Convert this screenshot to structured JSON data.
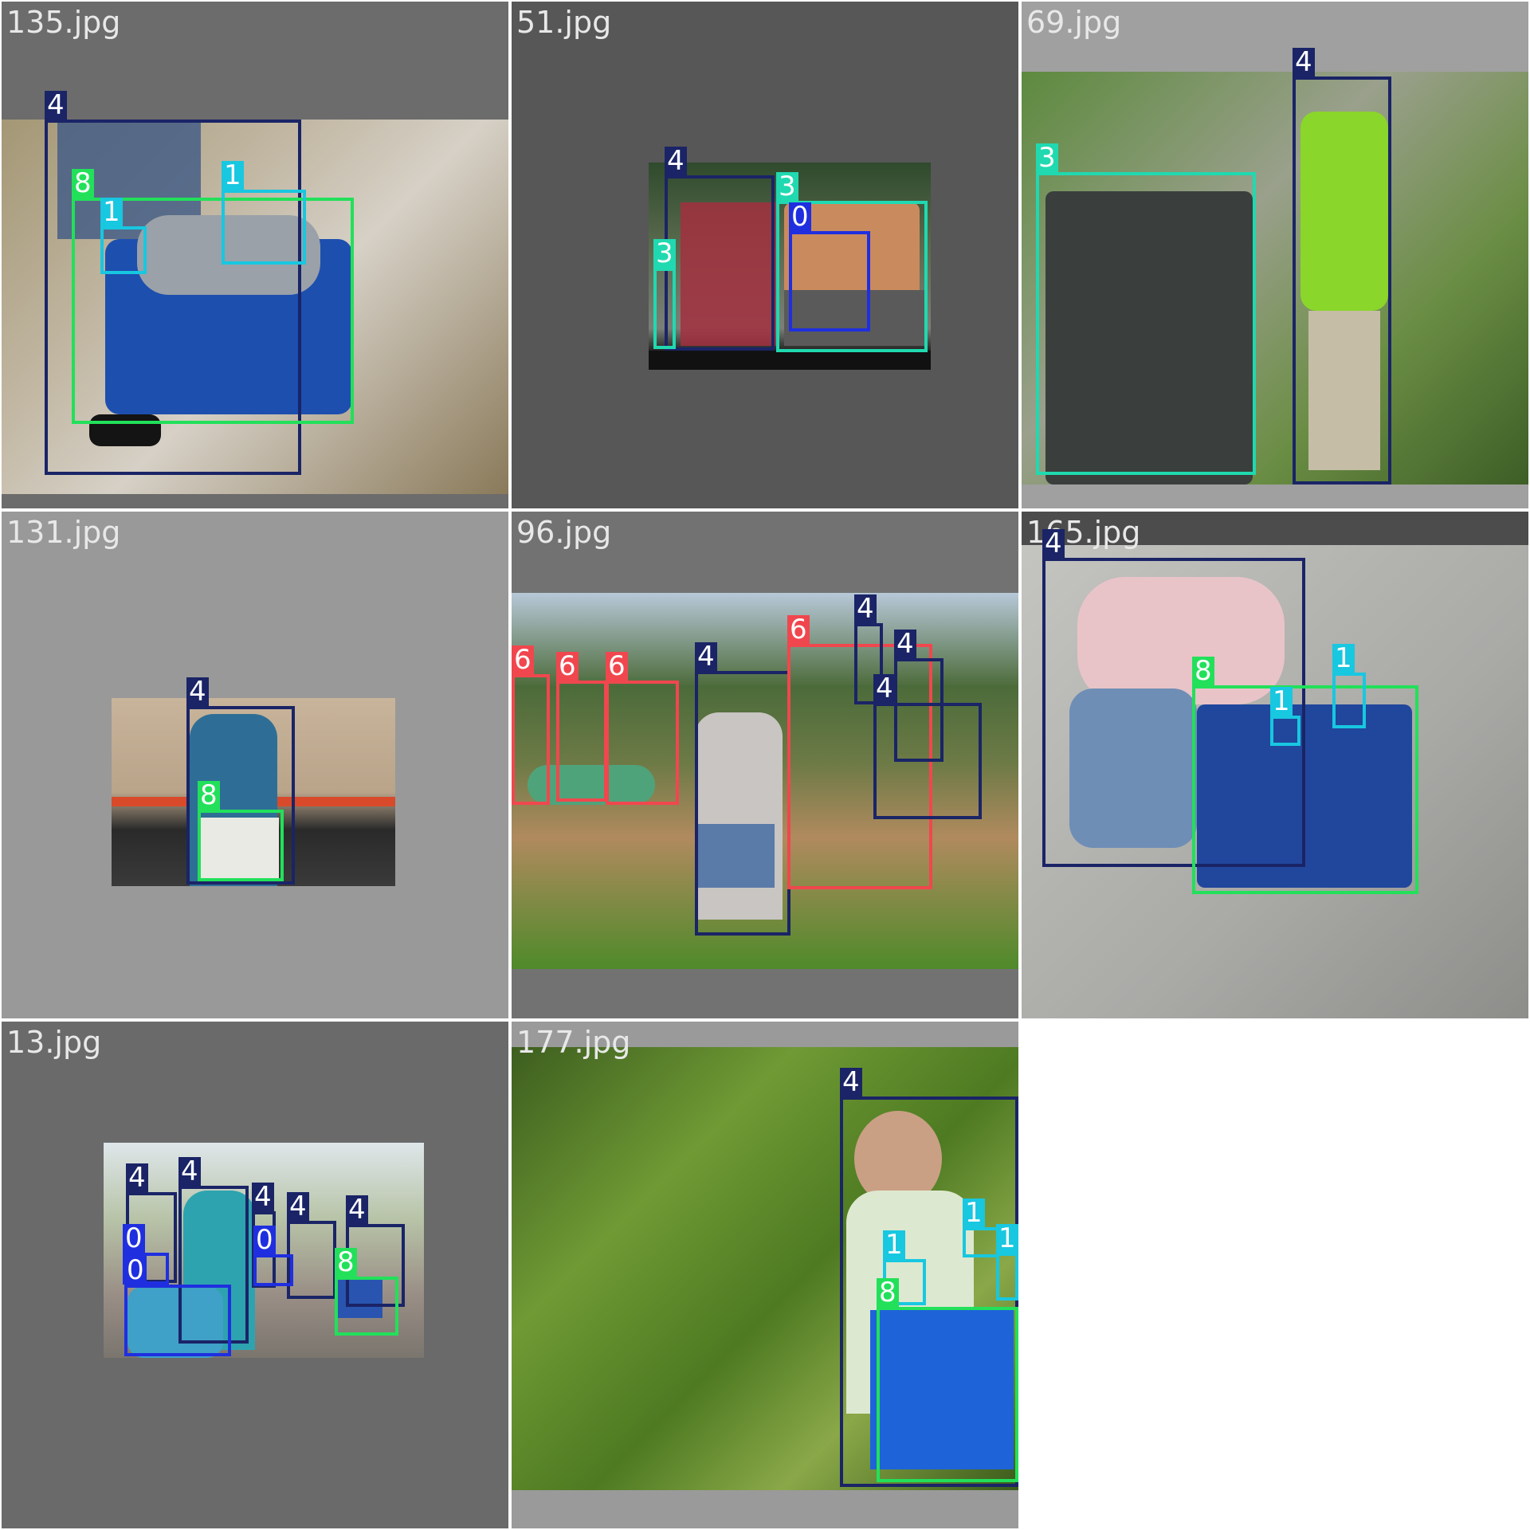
{
  "tiles": [
    {
      "filename": "135.jpg"
    },
    {
      "filename": "51.jpg"
    },
    {
      "filename": "69.jpg"
    },
    {
      "filename": "131.jpg"
    },
    {
      "filename": "96.jpg"
    },
    {
      "filename": "165.jpg"
    },
    {
      "filename": "13.jpg"
    },
    {
      "filename": "177.jpg"
    }
  ],
  "class_colors": {
    "0": "#1f2fe0",
    "1": "#18c7e0",
    "3": "#20d9b0",
    "4": "#1a2466",
    "6": "#f0474e",
    "8": "#22e05a"
  },
  "detections": [
    [
      {
        "cls": "4"
      },
      {
        "cls": "8"
      },
      {
        "cls": "1"
      },
      {
        "cls": "1"
      }
    ],
    [
      {
        "cls": "4"
      },
      {
        "cls": "3"
      },
      {
        "cls": "0"
      },
      {
        "cls": "3"
      }
    ],
    [
      {
        "cls": "4"
      },
      {
        "cls": "3"
      }
    ],
    [
      {
        "cls": "4"
      },
      {
        "cls": "8"
      }
    ],
    [
      {
        "cls": "6"
      },
      {
        "cls": "6"
      },
      {
        "cls": "6"
      },
      {
        "cls": "4"
      },
      {
        "cls": "6"
      },
      {
        "cls": "4"
      },
      {
        "cls": "4"
      },
      {
        "cls": "4"
      }
    ],
    [
      {
        "cls": "4"
      },
      {
        "cls": "8"
      },
      {
        "cls": "1"
      },
      {
        "cls": "1"
      }
    ],
    [
      {
        "cls": "4"
      },
      {
        "cls": "4"
      },
      {
        "cls": "4"
      },
      {
        "cls": "4"
      },
      {
        "cls": "4"
      },
      {
        "cls": "0"
      },
      {
        "cls": "0"
      },
      {
        "cls": "0"
      },
      {
        "cls": "8"
      }
    ],
    [
      {
        "cls": "4"
      },
      {
        "cls": "1"
      },
      {
        "cls": "1"
      },
      {
        "cls": "1"
      },
      {
        "cls": "8"
      }
    ]
  ]
}
